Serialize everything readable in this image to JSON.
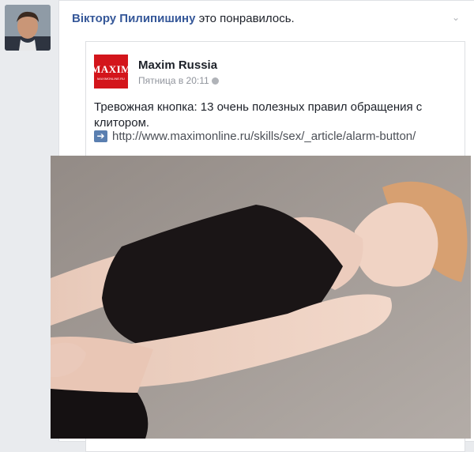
{
  "story": {
    "actor_name": "Віктору Пилипишину",
    "action_text": " это понравилось."
  },
  "post": {
    "page_name": "Maxim Russia",
    "logo_text": "MAXIM",
    "logo_subtext": "MAXIMONLINE.RU",
    "time": "Пятница в 20:11",
    "text": "Тревожная кнопка: 13 очень полезных правил обращения с клитором.",
    "link": "http://www.maximonline.ru/skills/sex/_article/alarm-button/"
  },
  "icons": {
    "arrow": "right-arrow-icon",
    "globe": "globe-icon",
    "chevron": "chevron-down-icon"
  },
  "colors": {
    "brand_red": "#d3151b",
    "link_blue": "#365899",
    "background": "#e9ebee"
  }
}
